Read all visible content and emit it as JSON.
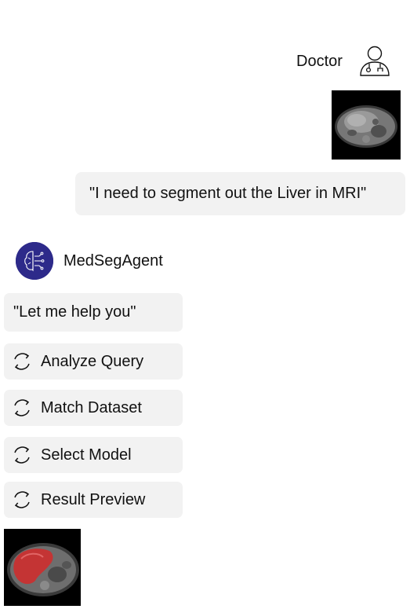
{
  "user": {
    "name": "Doctor",
    "icon": "doctor-icon",
    "message": "\"I need to segment out the Liver in MRI\""
  },
  "agent": {
    "name": "MedSegAgent",
    "icon": "brain-circuit-icon",
    "reply": "\"Let me help you\"",
    "steps": [
      {
        "label": "Analyze Query",
        "icon": "loading-icon"
      },
      {
        "label": "Match Dataset",
        "icon": "loading-icon"
      },
      {
        "label": "Select Model",
        "icon": "loading-icon"
      },
      {
        "label": "Result Preview",
        "icon": "loading-icon"
      }
    ]
  },
  "colors": {
    "bubble": "#f2f2f2",
    "avatar": "#2d2a8a",
    "segmentation": "#d42a2a"
  }
}
